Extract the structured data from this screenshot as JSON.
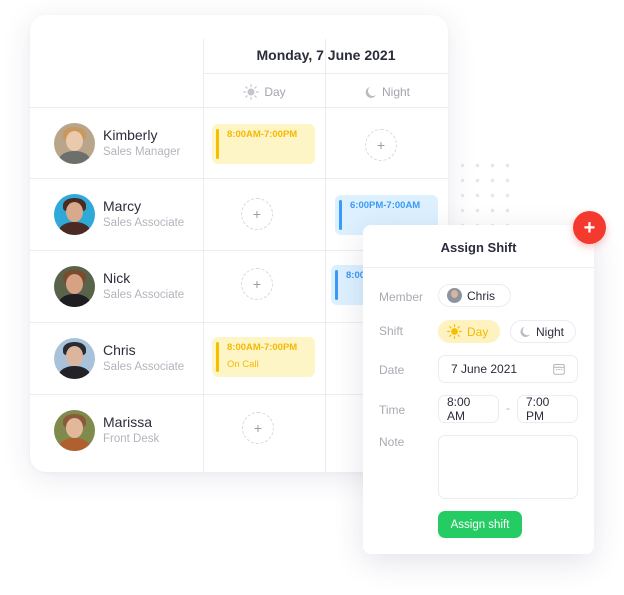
{
  "schedule": {
    "date_title": "Monday, 7 June 2021",
    "columns": [
      {
        "label": "Day",
        "icon": "sun-icon"
      },
      {
        "label": "Night",
        "icon": "moon-icon"
      }
    ],
    "members": [
      {
        "name": "Kimberly",
        "role": "Sales Manager"
      },
      {
        "name": "Marcy",
        "role": "Sales Associate"
      },
      {
        "name": "Nick",
        "role": "Sales Associate"
      },
      {
        "name": "Chris",
        "role": "Sales Associate"
      },
      {
        "name": "Marissa",
        "role": "Front Desk"
      }
    ],
    "shifts": [
      {
        "member": "Kimberly",
        "column": "Day",
        "time": "8:00AM-7:00PM",
        "note": ""
      },
      {
        "member": "Marcy",
        "column": "Night",
        "time": "6:00PM-7:00AM",
        "note": ""
      },
      {
        "member": "Nick",
        "column": "Night",
        "time": "8:00",
        "note": ""
      },
      {
        "member": "Chris",
        "column": "Day",
        "time": "8:00AM-7:00PM",
        "note": "On Call"
      }
    ],
    "add_slot_label": "+"
  },
  "assign_panel": {
    "title": "Assign Shift",
    "member_label": "Member",
    "member_value": "Chris",
    "shift_label": "Shift",
    "shift_options": [
      {
        "label": "Day",
        "icon": "sun-icon",
        "selected": true
      },
      {
        "label": "Night",
        "icon": "moon-icon",
        "selected": false
      }
    ],
    "date_label": "Date",
    "date_value": "7 June 2021",
    "time_label": "Time",
    "time_start": "8:00 AM",
    "time_separator": "-",
    "time_end": "7:00 PM",
    "note_label": "Note",
    "note_value": "",
    "submit_label": "Assign shift",
    "add_button_label": "+"
  },
  "colors": {
    "day_bg": "#fef5c6",
    "day_accent": "#f9bd00",
    "night_bg": "#dcf0ff",
    "night_accent": "#3a9af5",
    "primary_green": "#24cc63",
    "fab_red": "#f4392f"
  }
}
